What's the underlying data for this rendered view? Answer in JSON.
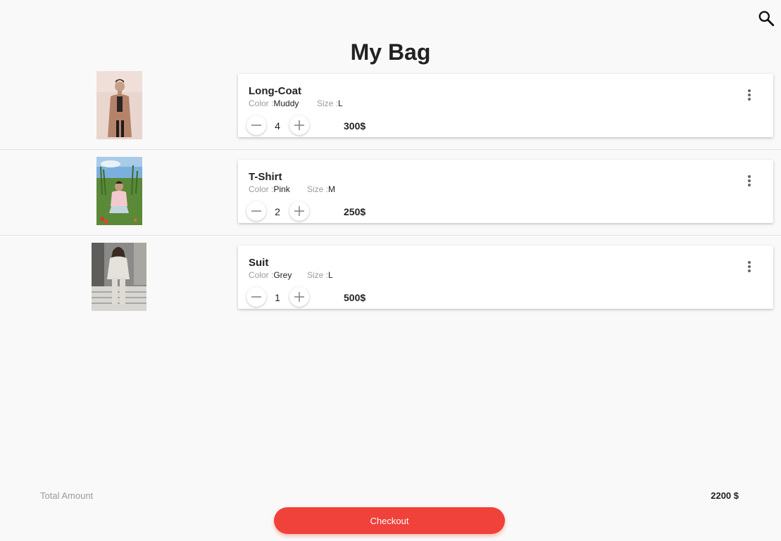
{
  "header": {
    "title": "My Bag",
    "search_icon": "search-icon"
  },
  "labels": {
    "color": "Color :",
    "size": "Size :"
  },
  "items": [
    {
      "name": "Long-Coat",
      "color": "Muddy",
      "size": "L",
      "quantity": "4",
      "price": "300$"
    },
    {
      "name": "T-Shirt",
      "color": "Pink",
      "size": "M",
      "quantity": "2",
      "price": "250$"
    },
    {
      "name": "Suit",
      "color": "Grey",
      "size": "L",
      "quantity": "1",
      "price": "500$"
    }
  ],
  "footer": {
    "total_label": "Total Amount",
    "total_value": "2200 $",
    "checkout_label": "Checkout"
  },
  "colors": {
    "accent": "#f0413a",
    "background": "#f9f9f9"
  }
}
